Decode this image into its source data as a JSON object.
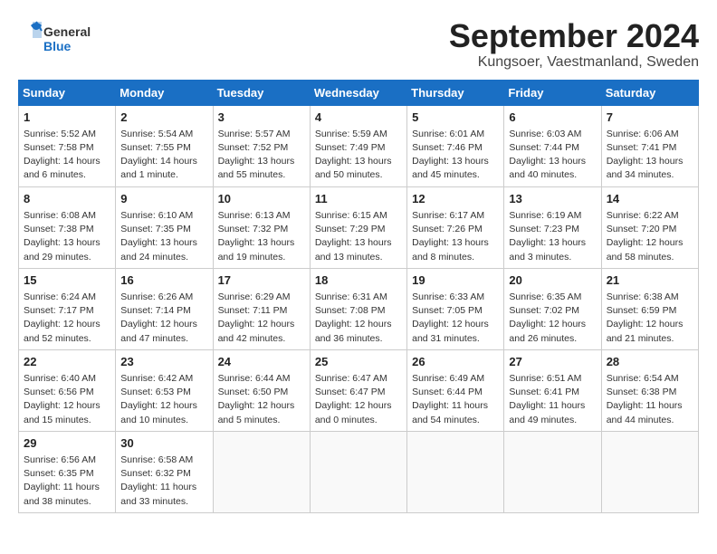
{
  "logo": {
    "line1": "General",
    "line2": "Blue"
  },
  "title": "September 2024",
  "location": "Kungsoer, Vaestmanland, Sweden",
  "days_of_week": [
    "Sunday",
    "Monday",
    "Tuesday",
    "Wednesday",
    "Thursday",
    "Friday",
    "Saturday"
  ],
  "weeks": [
    [
      {
        "day": 1,
        "info": "Sunrise: 5:52 AM\nSunset: 7:58 PM\nDaylight: 14 hours\nand 6 minutes."
      },
      {
        "day": 2,
        "info": "Sunrise: 5:54 AM\nSunset: 7:55 PM\nDaylight: 14 hours\nand 1 minute."
      },
      {
        "day": 3,
        "info": "Sunrise: 5:57 AM\nSunset: 7:52 PM\nDaylight: 13 hours\nand 55 minutes."
      },
      {
        "day": 4,
        "info": "Sunrise: 5:59 AM\nSunset: 7:49 PM\nDaylight: 13 hours\nand 50 minutes."
      },
      {
        "day": 5,
        "info": "Sunrise: 6:01 AM\nSunset: 7:46 PM\nDaylight: 13 hours\nand 45 minutes."
      },
      {
        "day": 6,
        "info": "Sunrise: 6:03 AM\nSunset: 7:44 PM\nDaylight: 13 hours\nand 40 minutes."
      },
      {
        "day": 7,
        "info": "Sunrise: 6:06 AM\nSunset: 7:41 PM\nDaylight: 13 hours\nand 34 minutes."
      }
    ],
    [
      {
        "day": 8,
        "info": "Sunrise: 6:08 AM\nSunset: 7:38 PM\nDaylight: 13 hours\nand 29 minutes."
      },
      {
        "day": 9,
        "info": "Sunrise: 6:10 AM\nSunset: 7:35 PM\nDaylight: 13 hours\nand 24 minutes."
      },
      {
        "day": 10,
        "info": "Sunrise: 6:13 AM\nSunset: 7:32 PM\nDaylight: 13 hours\nand 19 minutes."
      },
      {
        "day": 11,
        "info": "Sunrise: 6:15 AM\nSunset: 7:29 PM\nDaylight: 13 hours\nand 13 minutes."
      },
      {
        "day": 12,
        "info": "Sunrise: 6:17 AM\nSunset: 7:26 PM\nDaylight: 13 hours\nand 8 minutes."
      },
      {
        "day": 13,
        "info": "Sunrise: 6:19 AM\nSunset: 7:23 PM\nDaylight: 13 hours\nand 3 minutes."
      },
      {
        "day": 14,
        "info": "Sunrise: 6:22 AM\nSunset: 7:20 PM\nDaylight: 12 hours\nand 58 minutes."
      }
    ],
    [
      {
        "day": 15,
        "info": "Sunrise: 6:24 AM\nSunset: 7:17 PM\nDaylight: 12 hours\nand 52 minutes."
      },
      {
        "day": 16,
        "info": "Sunrise: 6:26 AM\nSunset: 7:14 PM\nDaylight: 12 hours\nand 47 minutes."
      },
      {
        "day": 17,
        "info": "Sunrise: 6:29 AM\nSunset: 7:11 PM\nDaylight: 12 hours\nand 42 minutes."
      },
      {
        "day": 18,
        "info": "Sunrise: 6:31 AM\nSunset: 7:08 PM\nDaylight: 12 hours\nand 36 minutes."
      },
      {
        "day": 19,
        "info": "Sunrise: 6:33 AM\nSunset: 7:05 PM\nDaylight: 12 hours\nand 31 minutes."
      },
      {
        "day": 20,
        "info": "Sunrise: 6:35 AM\nSunset: 7:02 PM\nDaylight: 12 hours\nand 26 minutes."
      },
      {
        "day": 21,
        "info": "Sunrise: 6:38 AM\nSunset: 6:59 PM\nDaylight: 12 hours\nand 21 minutes."
      }
    ],
    [
      {
        "day": 22,
        "info": "Sunrise: 6:40 AM\nSunset: 6:56 PM\nDaylight: 12 hours\nand 15 minutes."
      },
      {
        "day": 23,
        "info": "Sunrise: 6:42 AM\nSunset: 6:53 PM\nDaylight: 12 hours\nand 10 minutes."
      },
      {
        "day": 24,
        "info": "Sunrise: 6:44 AM\nSunset: 6:50 PM\nDaylight: 12 hours\nand 5 minutes."
      },
      {
        "day": 25,
        "info": "Sunrise: 6:47 AM\nSunset: 6:47 PM\nDaylight: 12 hours\nand 0 minutes."
      },
      {
        "day": 26,
        "info": "Sunrise: 6:49 AM\nSunset: 6:44 PM\nDaylight: 11 hours\nand 54 minutes."
      },
      {
        "day": 27,
        "info": "Sunrise: 6:51 AM\nSunset: 6:41 PM\nDaylight: 11 hours\nand 49 minutes."
      },
      {
        "day": 28,
        "info": "Sunrise: 6:54 AM\nSunset: 6:38 PM\nDaylight: 11 hours\nand 44 minutes."
      }
    ],
    [
      {
        "day": 29,
        "info": "Sunrise: 6:56 AM\nSunset: 6:35 PM\nDaylight: 11 hours\nand 38 minutes."
      },
      {
        "day": 30,
        "info": "Sunrise: 6:58 AM\nSunset: 6:32 PM\nDaylight: 11 hours\nand 33 minutes."
      },
      null,
      null,
      null,
      null,
      null
    ]
  ]
}
